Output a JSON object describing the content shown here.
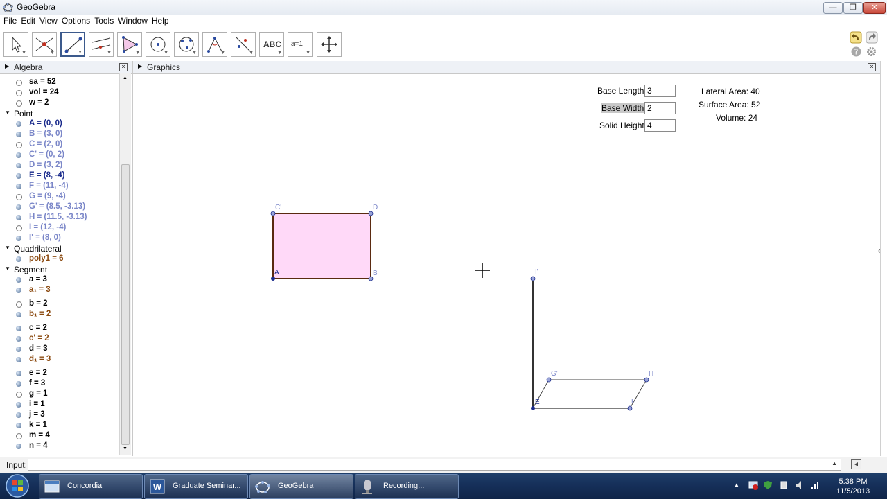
{
  "window": {
    "title": "GeoGebra",
    "minimize": "—",
    "maximize": "❐",
    "close": "✕"
  },
  "menu": [
    "File",
    "Edit",
    "View",
    "Options",
    "Tools",
    "Window",
    "Help"
  ],
  "toolbar": {
    "tools": [
      "move-tool",
      "point-tool",
      "segment-tool",
      "perpendicular-line-tool",
      "polygon-tool",
      "circle-tool",
      "conic-tool",
      "angle-tool",
      "reflect-tool",
      "text-tool",
      "slider-tool",
      "move-graphics-tool"
    ],
    "text_tool_label": "ABC",
    "slider_tool_label": "a=1"
  },
  "algebra": {
    "title": "Algebra",
    "close": "×",
    "rows": [
      {
        "kind": "item",
        "text": "sa = 52",
        "visible": false,
        "color": "#000000"
      },
      {
        "kind": "item",
        "text": "vol = 24",
        "visible": false,
        "color": "#000000"
      },
      {
        "kind": "item",
        "text": "w = 2",
        "visible": false,
        "color": "#000000"
      },
      {
        "kind": "cat",
        "text": "Point"
      },
      {
        "kind": "item",
        "text": "A = (0, 0)",
        "visible": true,
        "color": "#1a2b8c"
      },
      {
        "kind": "item",
        "text": "B = (3, 0)",
        "visible": true,
        "color": "#7a86c8"
      },
      {
        "kind": "item",
        "text": "C = (2, 0)",
        "visible": false,
        "color": "#7a86c8"
      },
      {
        "kind": "item",
        "text": "C' = (0, 2)",
        "visible": true,
        "color": "#7a86c8"
      },
      {
        "kind": "item",
        "text": "D = (3, 2)",
        "visible": true,
        "color": "#7a86c8"
      },
      {
        "kind": "item",
        "text": "E = (8, -4)",
        "visible": true,
        "color": "#1a2b8c"
      },
      {
        "kind": "item",
        "text": "F = (11, -4)",
        "visible": true,
        "color": "#7a86c8"
      },
      {
        "kind": "item",
        "text": "G = (9, -4)",
        "visible": false,
        "color": "#7a86c8"
      },
      {
        "kind": "item",
        "text": "G' = (8.5, -3.13)",
        "visible": true,
        "color": "#7a86c8"
      },
      {
        "kind": "item",
        "text": "H = (11.5, -3.13)",
        "visible": true,
        "color": "#7a86c8"
      },
      {
        "kind": "item",
        "text": "I = (12, -4)",
        "visible": false,
        "color": "#7a86c8"
      },
      {
        "kind": "item",
        "text": "I' = (8, 0)",
        "visible": true,
        "color": "#7a86c8"
      },
      {
        "kind": "cat",
        "text": "Quadrilateral"
      },
      {
        "kind": "item",
        "text": "poly1 = 6",
        "visible": true,
        "color": "#8b4a10"
      },
      {
        "kind": "cat",
        "text": "Segment"
      },
      {
        "kind": "item",
        "text": "a = 3",
        "visible": true,
        "color": "#000000"
      },
      {
        "kind": "item",
        "text": "a₁ = 3",
        "visible": true,
        "color": "#8b4a10"
      },
      {
        "kind": "item",
        "text": "b = 2",
        "visible": false,
        "color": "#000000"
      },
      {
        "kind": "item",
        "text": "b₁ = 2",
        "visible": true,
        "color": "#8b4a10"
      },
      {
        "kind": "item",
        "text": "c = 2",
        "visible": true,
        "color": "#000000"
      },
      {
        "kind": "item",
        "text": "c' = 2",
        "visible": true,
        "color": "#8b4a10"
      },
      {
        "kind": "item",
        "text": "d = 3",
        "visible": true,
        "color": "#000000"
      },
      {
        "kind": "item",
        "text": "d₁ = 3",
        "visible": true,
        "color": "#8b4a10"
      },
      {
        "kind": "item",
        "text": "e = 2",
        "visible": true,
        "color": "#000000"
      },
      {
        "kind": "item",
        "text": "f = 3",
        "visible": true,
        "color": "#000000"
      },
      {
        "kind": "item",
        "text": "g = 1",
        "visible": false,
        "color": "#000000"
      },
      {
        "kind": "item",
        "text": "i = 1",
        "visible": true,
        "color": "#000000"
      },
      {
        "kind": "item",
        "text": "j = 3",
        "visible": true,
        "color": "#000000"
      },
      {
        "kind": "item",
        "text": "k = 1",
        "visible": true,
        "color": "#000000"
      },
      {
        "kind": "item",
        "text": "m = 4",
        "visible": false,
        "color": "#000000"
      },
      {
        "kind": "item",
        "text": "n = 4",
        "visible": true,
        "color": "#000000"
      }
    ]
  },
  "graphics": {
    "title": "Graphics",
    "close": "×",
    "fields": {
      "base_length_label": "Base Length:",
      "base_length_value": "3",
      "base_width_label": "Base Width:",
      "base_width_value": "2",
      "solid_height_label": "Solid Height:",
      "solid_height_value": "4"
    },
    "info": {
      "lateral": "Lateral Area: 40",
      "surface": "Surface Area: 52",
      "volume": "Volume: 24"
    },
    "point_labels": {
      "A": "A",
      "B": "B",
      "Cp": "C'",
      "D": "D",
      "Ip": "I'",
      "Gp": "G'",
      "H": "H",
      "E": "E",
      "F": "F"
    },
    "colors": {
      "rect_fill": "#ffd9f8",
      "rect_stroke": "#5a2a10",
      "point": "#1a2b8c",
      "point_light": "#7a86c8"
    }
  },
  "input": {
    "label": "Input:"
  },
  "taskbar": {
    "tasks": [
      "Concordia",
      "Graduate Seminar...",
      "GeoGebra",
      "Recording..."
    ],
    "time": "5:38 PM",
    "date": "11/5/2013"
  }
}
